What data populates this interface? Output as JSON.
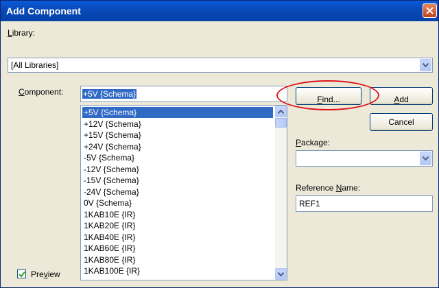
{
  "window": {
    "title": "Add Component"
  },
  "library": {
    "label_accel": "L",
    "label_rest": "ibrary:",
    "selected": "[All Libraries]"
  },
  "component": {
    "label_accel": "C",
    "label_rest": "omponent:",
    "value": "+5V {Schema}",
    "items": [
      "+5V {Schema}",
      "+12V {Schema}",
      "+15V {Schema}",
      "+24V {Schema}",
      "-5V {Schema}",
      "-12V {Schema}",
      "-15V {Schema}",
      "-24V {Schema}",
      "0V {Schema}",
      "1KAB10E {IR}",
      "1KAB20E {IR}",
      "1KAB40E {IR}",
      "1KAB60E {IR}",
      "1KAB80E {IR}",
      "1KAB100E {IR}"
    ],
    "selected_index": 0
  },
  "buttons": {
    "find_accel": "F",
    "find_rest": "ind...",
    "add_accel": "A",
    "add_rest": "dd",
    "cancel": "Cancel"
  },
  "package": {
    "label_accel": "P",
    "label_rest": "ackage:",
    "selected": ""
  },
  "reference": {
    "label_pre": "Reference ",
    "label_accel": "N",
    "label_rest": "ame:",
    "value": "REF1"
  },
  "preview": {
    "label_pre": "Pre",
    "label_accel": "v",
    "label_rest": "iew",
    "checked": true
  },
  "colors": {
    "highlight_ellipse": "#e0121a",
    "selection": "#316ac5",
    "titlebar": "#0a5ad8"
  }
}
